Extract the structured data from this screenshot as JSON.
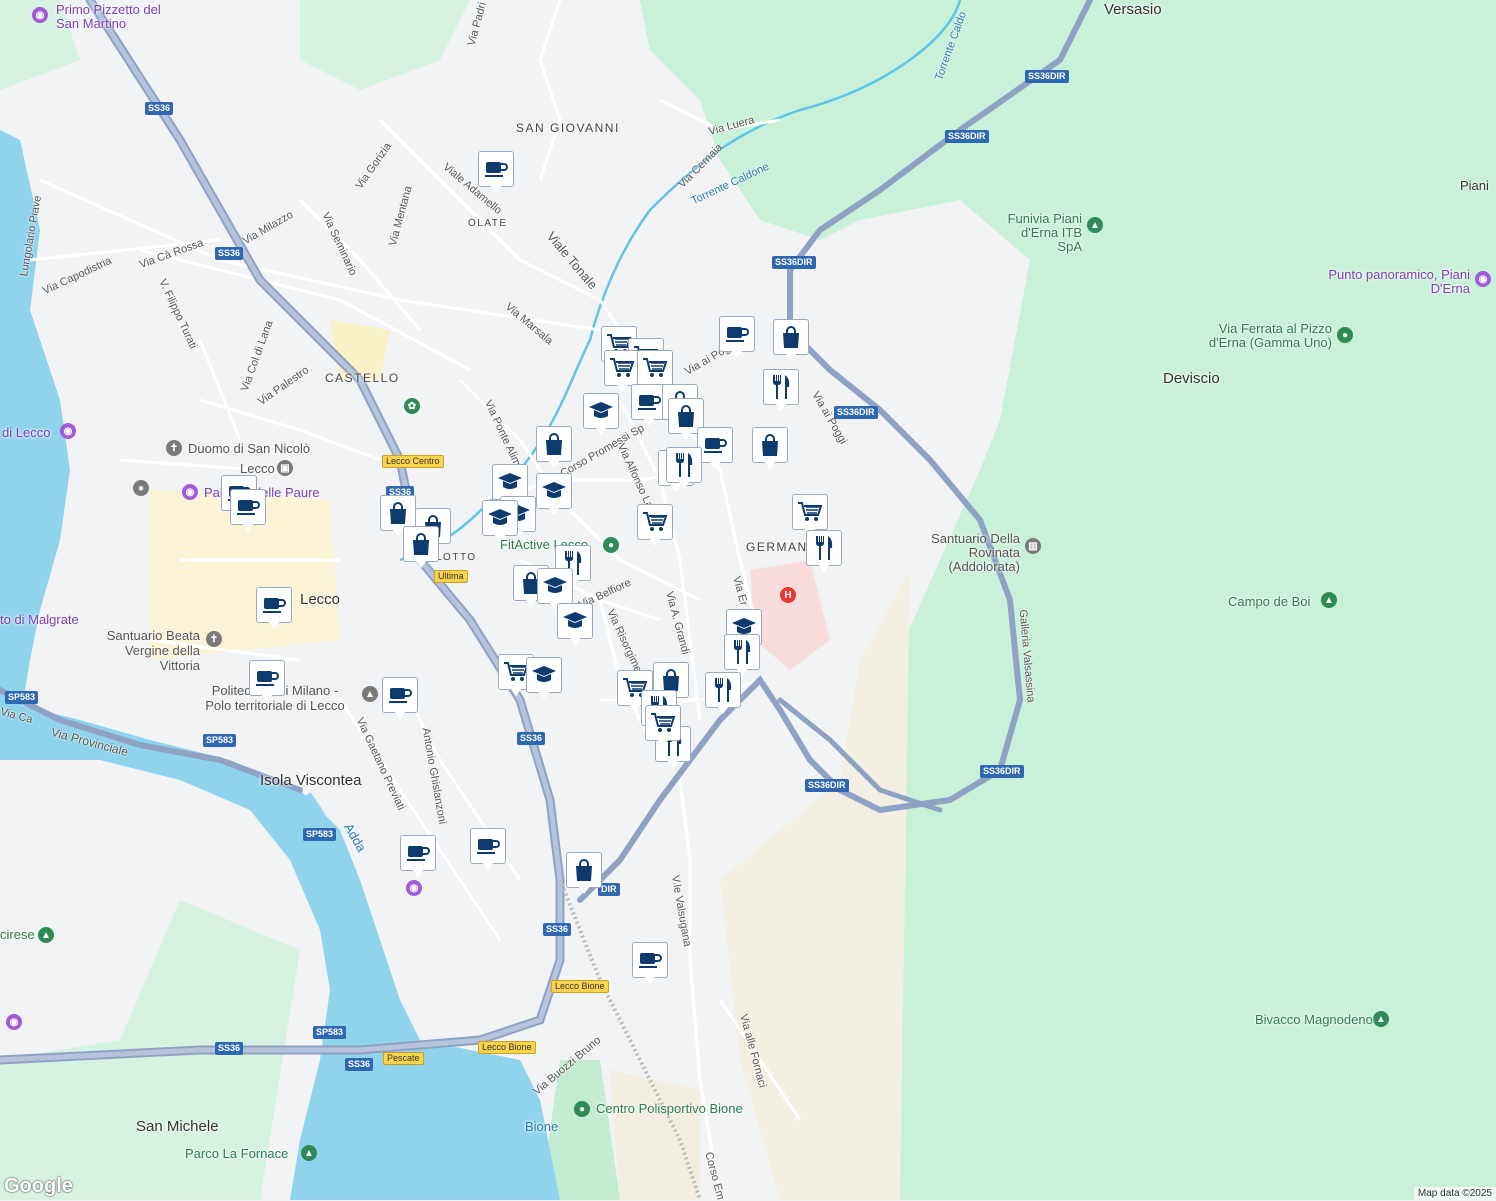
{
  "place_labels": [
    "Versasio",
    "SAN GIOVANNI",
    "OLATE",
    "CASTELLO",
    "Lecco",
    "Deviscio",
    "Piani",
    "GERMAN",
    "San Michele",
    "Isola Viscontea",
    "Bione",
    "LOTTO"
  ],
  "street_labels": [
    "Via Padri",
    "Lungolario Piave",
    "Via Capodistria",
    "Via Cà Rossa",
    "V. Filippo Turati",
    "Via Col di Lana",
    "Via Palestro",
    "Via Milazzo",
    "Via Seminario",
    "Via Mentana",
    "Via Gorizia",
    "Viale Adamello",
    "Viale Tonale",
    "Via Marsala",
    "Via Luera",
    "Via Cernaia",
    "Torrente Caldone",
    "Torrente Caldo",
    "Via ai Poggi",
    "Via ai Poggi",
    "Via Ponte Alimp",
    "Corso Promessi Sp",
    "Via Alfonso La",
    "Via Belfiore",
    "Via Risorgime",
    "Via A. Grandi",
    "Via Er",
    "Via Gaetano Previati",
    "Antonio Ghislanzoni",
    "Via Provinciale",
    "V.le Valsugana",
    "Via alle Fornaci",
    "Via Buozzi Bruno",
    "Corso Em",
    "Galleria Valsassina",
    "Adda",
    "Via Ca"
  ],
  "road_shields": [
    "SS36",
    "SS36",
    "SS36",
    "SS36",
    "SS36",
    "SS36",
    "SS36DIR",
    "SS36DIR",
    "SS36DIR",
    "SS36DIR",
    "SS36DIR",
    "SS36DIR",
    "SP583",
    "SP583",
    "SP583",
    "SP583",
    "DIR"
  ],
  "yellow_shields": [
    "Lecco Centro",
    "Ultima",
    "Lecco Bione",
    "Lecco Bione",
    "Pescate"
  ],
  "pois": {
    "purple": [
      "Primo Pizzetto del San Martino",
      "Punto panoramico, Piani D'Erna",
      "di Lecco",
      "Palazzo delle Paure",
      "to di Malgrate"
    ],
    "green": [
      "Funivia Piani d'Erna ITB SpA",
      "Via Ferrata al Pizzo d'Erna (Gamma Uno)",
      "Campo de Boi",
      "Bivacco Magnodeno",
      "FitActive Lecco",
      "Centro Polisportivo Bione",
      "Parco La Fornace",
      "cirese"
    ],
    "gray": [
      "Duomo di San Nicolò",
      "Lecco",
      "Santuario Beata Vergine della Vittoria",
      "Politecnico di Milano - Polo territoriale di Lecco",
      "Santuario Della Rovinata (Addolorata)"
    ]
  },
  "marker_counts": {
    "coffee": 12,
    "cart": 9,
    "bag": 9,
    "school": 10,
    "restaurant": 8
  },
  "colors": {
    "marker_icon": "#0d3b6e",
    "water": "#8fd3ec",
    "park": "#c9f0d9",
    "road": "#ffffff",
    "highway": "#8fa2c4",
    "shield": "#2f67b0"
  },
  "footer": {
    "credit": "Map data ©2025",
    "logo": "Google"
  }
}
